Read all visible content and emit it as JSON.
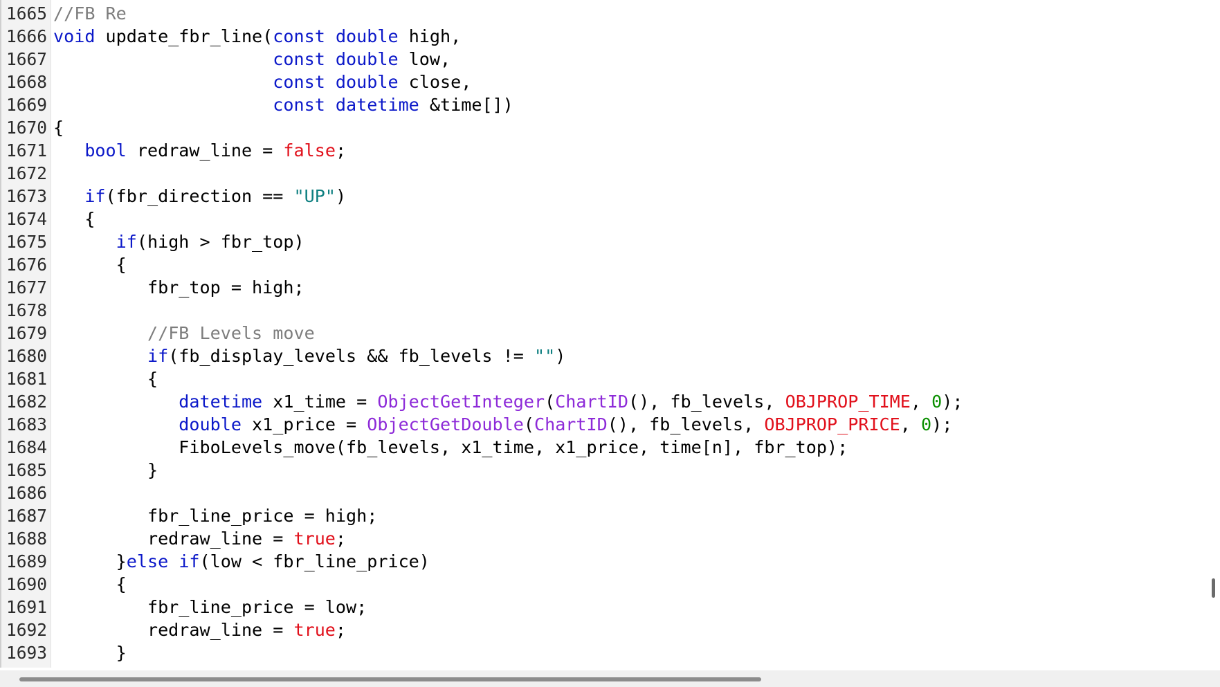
{
  "editor": {
    "lines": [
      {
        "num": "1665",
        "tokens": [
          {
            "t": "//FB Re",
            "c": "cm"
          }
        ]
      },
      {
        "num": "1666",
        "tokens": [
          {
            "t": "void",
            "c": "kw"
          },
          {
            "t": " update_fbr_line(",
            "c": "id"
          },
          {
            "t": "const",
            "c": "kw"
          },
          {
            "t": " ",
            "c": "id"
          },
          {
            "t": "double",
            "c": "kw"
          },
          {
            "t": " high,",
            "c": "id"
          }
        ]
      },
      {
        "num": "1667",
        "tokens": [
          {
            "t": "                     ",
            "c": "id"
          },
          {
            "t": "const",
            "c": "kw"
          },
          {
            "t": " ",
            "c": "id"
          },
          {
            "t": "double",
            "c": "kw"
          },
          {
            "t": " low,",
            "c": "id"
          }
        ]
      },
      {
        "num": "1668",
        "tokens": [
          {
            "t": "                     ",
            "c": "id"
          },
          {
            "t": "const",
            "c": "kw"
          },
          {
            "t": " ",
            "c": "id"
          },
          {
            "t": "double",
            "c": "kw"
          },
          {
            "t": " close,",
            "c": "id"
          }
        ]
      },
      {
        "num": "1669",
        "tokens": [
          {
            "t": "                     ",
            "c": "id"
          },
          {
            "t": "const",
            "c": "kw"
          },
          {
            "t": " ",
            "c": "id"
          },
          {
            "t": "datetime",
            "c": "kw"
          },
          {
            "t": " &time[])",
            "c": "id"
          }
        ]
      },
      {
        "num": "1670",
        "tokens": [
          {
            "t": "{",
            "c": "pn"
          }
        ]
      },
      {
        "num": "1671",
        "tokens": [
          {
            "t": "   ",
            "c": "id"
          },
          {
            "t": "bool",
            "c": "kw"
          },
          {
            "t": " redraw_line = ",
            "c": "id"
          },
          {
            "t": "false",
            "c": "red"
          },
          {
            "t": ";",
            "c": "id"
          }
        ]
      },
      {
        "num": "1672",
        "tokens": []
      },
      {
        "num": "1673",
        "tokens": [
          {
            "t": "   ",
            "c": "id"
          },
          {
            "t": "if",
            "c": "kw"
          },
          {
            "t": "(fbr_direction == ",
            "c": "id"
          },
          {
            "t": "\"UP\"",
            "c": "str"
          },
          {
            "t": ")",
            "c": "id"
          }
        ]
      },
      {
        "num": "1674",
        "tokens": [
          {
            "t": "   {",
            "c": "pn"
          }
        ]
      },
      {
        "num": "1675",
        "tokens": [
          {
            "t": "      ",
            "c": "id"
          },
          {
            "t": "if",
            "c": "kw"
          },
          {
            "t": "(high > fbr_top)",
            "c": "id"
          }
        ]
      },
      {
        "num": "1676",
        "tokens": [
          {
            "t": "      {",
            "c": "pn"
          }
        ]
      },
      {
        "num": "1677",
        "tokens": [
          {
            "t": "         fbr_top = high;",
            "c": "id"
          }
        ]
      },
      {
        "num": "1678",
        "tokens": []
      },
      {
        "num": "1679",
        "tokens": [
          {
            "t": "         ",
            "c": "id"
          },
          {
            "t": "//FB Levels move",
            "c": "cm"
          }
        ]
      },
      {
        "num": "1680",
        "tokens": [
          {
            "t": "         ",
            "c": "id"
          },
          {
            "t": "if",
            "c": "kw"
          },
          {
            "t": "(fb_display_levels && fb_levels != ",
            "c": "id"
          },
          {
            "t": "\"\"",
            "c": "str"
          },
          {
            "t": ")",
            "c": "id"
          }
        ]
      },
      {
        "num": "1681",
        "tokens": [
          {
            "t": "         {",
            "c": "pn"
          }
        ]
      },
      {
        "num": "1682",
        "tokens": [
          {
            "t": "            ",
            "c": "id"
          },
          {
            "t": "datetime",
            "c": "kw"
          },
          {
            "t": " x1_time = ",
            "c": "id"
          },
          {
            "t": "ObjectGetInteger",
            "c": "fn"
          },
          {
            "t": "(",
            "c": "id"
          },
          {
            "t": "ChartID",
            "c": "fn"
          },
          {
            "t": "(), fb_levels, ",
            "c": "id"
          },
          {
            "t": "OBJPROP_TIME",
            "c": "red"
          },
          {
            "t": ", ",
            "c": "id"
          },
          {
            "t": "0",
            "c": "num"
          },
          {
            "t": ");",
            "c": "id"
          }
        ]
      },
      {
        "num": "1683",
        "tokens": [
          {
            "t": "            ",
            "c": "id"
          },
          {
            "t": "double",
            "c": "kw"
          },
          {
            "t": " x1_price = ",
            "c": "id"
          },
          {
            "t": "ObjectGetDouble",
            "c": "fn"
          },
          {
            "t": "(",
            "c": "id"
          },
          {
            "t": "ChartID",
            "c": "fn"
          },
          {
            "t": "(), fb_levels, ",
            "c": "id"
          },
          {
            "t": "OBJPROP_PRICE",
            "c": "red"
          },
          {
            "t": ", ",
            "c": "id"
          },
          {
            "t": "0",
            "c": "num"
          },
          {
            "t": ");",
            "c": "id"
          }
        ]
      },
      {
        "num": "1684",
        "tokens": [
          {
            "t": "            FiboLevels_move(fb_levels, x1_time, x1_price, time[n], fbr_top);",
            "c": "id"
          }
        ]
      },
      {
        "num": "1685",
        "tokens": [
          {
            "t": "         }",
            "c": "pn"
          }
        ]
      },
      {
        "num": "1686",
        "tokens": []
      },
      {
        "num": "1687",
        "tokens": [
          {
            "t": "         fbr_line_price = high;",
            "c": "id"
          }
        ]
      },
      {
        "num": "1688",
        "tokens": [
          {
            "t": "         redraw_line = ",
            "c": "id"
          },
          {
            "t": "true",
            "c": "red"
          },
          {
            "t": ";",
            "c": "id"
          }
        ]
      },
      {
        "num": "1689",
        "tokens": [
          {
            "t": "      }",
            "c": "pn"
          },
          {
            "t": "else",
            "c": "kw"
          },
          {
            "t": " ",
            "c": "id"
          },
          {
            "t": "if",
            "c": "kw"
          },
          {
            "t": "(low < fbr_line_price)",
            "c": "id"
          }
        ]
      },
      {
        "num": "1690",
        "tokens": [
          {
            "t": "      {",
            "c": "pn"
          }
        ]
      },
      {
        "num": "1691",
        "tokens": [
          {
            "t": "         fbr_line_price = low;",
            "c": "id"
          }
        ]
      },
      {
        "num": "1692",
        "tokens": [
          {
            "t": "         redraw_line = ",
            "c": "id"
          },
          {
            "t": "true",
            "c": "red"
          },
          {
            "t": ";",
            "c": "id"
          }
        ]
      },
      {
        "num": "1693",
        "tokens": [
          {
            "t": "      }",
            "c": "pn"
          }
        ]
      }
    ]
  },
  "colors": {
    "keyword": "#0b18c9",
    "comment": "#7d7d7d",
    "constant": "#e1101b",
    "string": "#0d7f80",
    "function": "#8d2ad8",
    "number": "#0a8f00"
  }
}
